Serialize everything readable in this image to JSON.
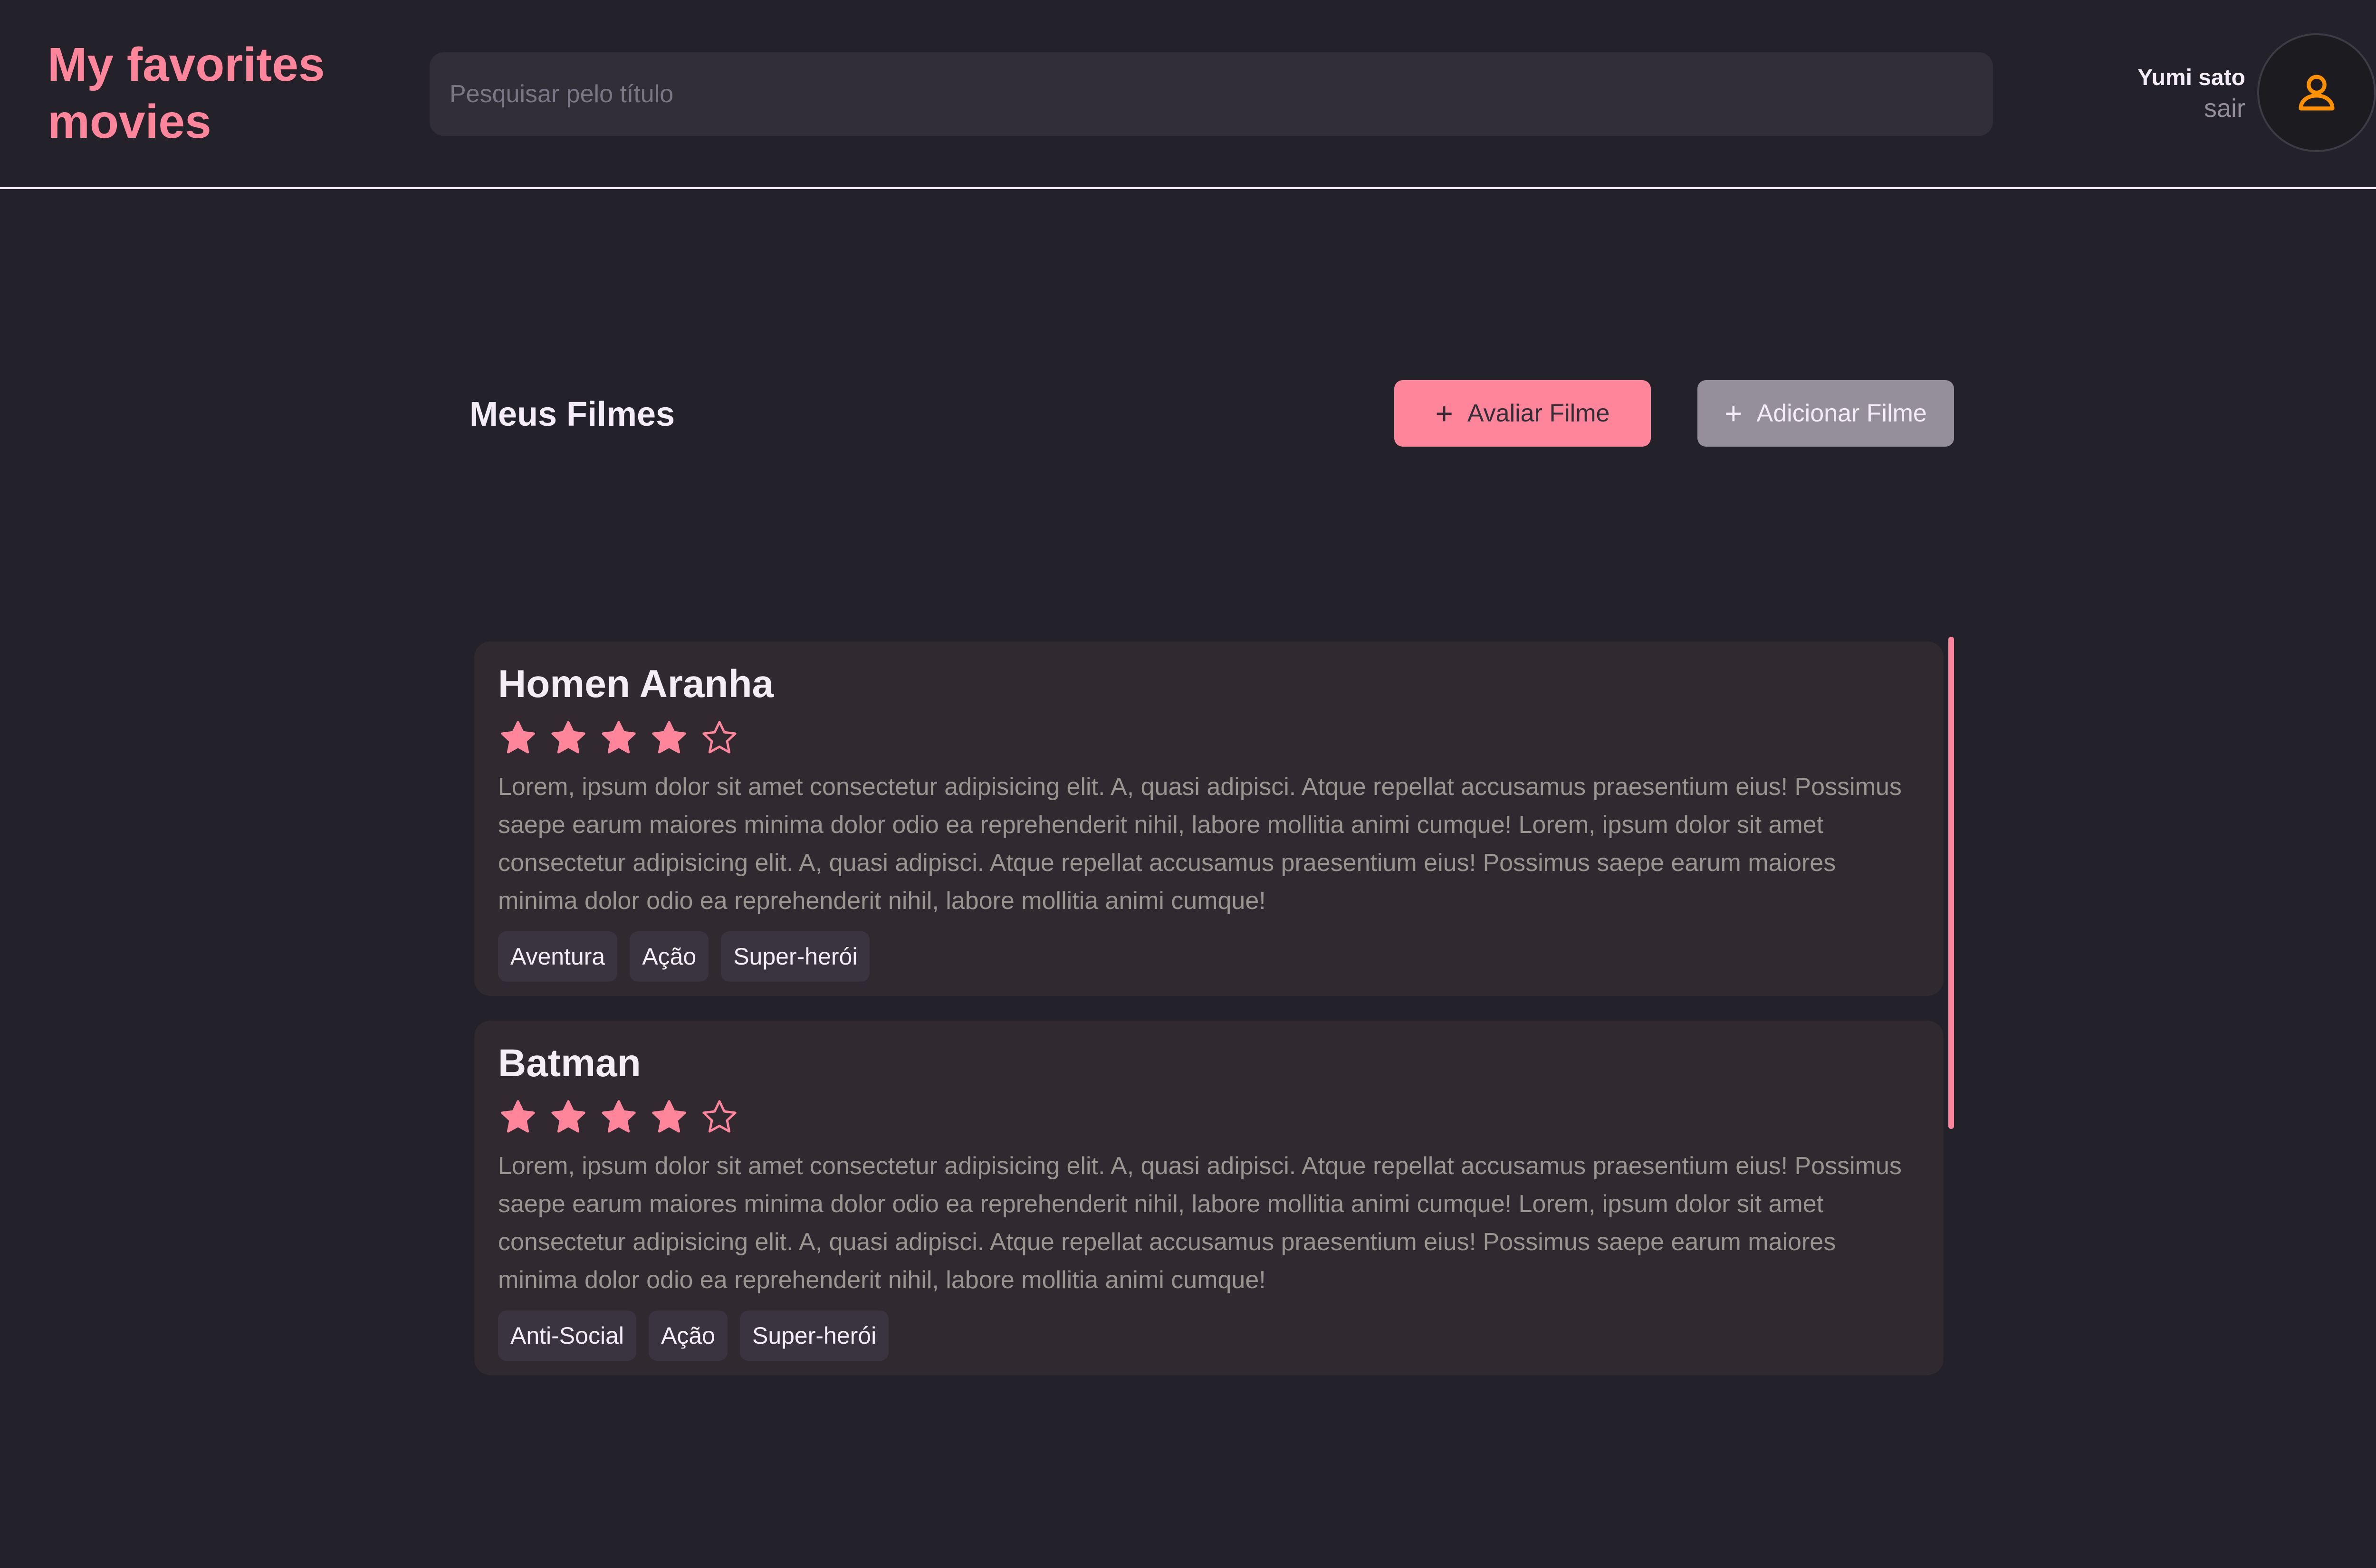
{
  "app": {
    "title": "My favorites movies"
  },
  "search": {
    "placeholder": "Pesquisar pelo título",
    "value": ""
  },
  "user": {
    "name": "Yumi sato",
    "signout_label": "sair",
    "avatar_icon": "user-icon"
  },
  "main": {
    "section_title": "Meus Filmes",
    "rate_button_label": "Avaliar Filme",
    "add_button_label": "Adicionar Filme"
  },
  "movies": [
    {
      "title": "Homen Aranha",
      "rating": 4,
      "max_rating": 5,
      "description": "Lorem, ipsum dolor sit amet consectetur adipisicing elit. A, quasi adipisci. Atque repellat accusamus praesentium eius! Possimus saepe earum maiores minima dolor odio ea reprehenderit nihil, labore mollitia animi cumque! Lorem, ipsum dolor sit amet consectetur adipisicing elit. A, quasi adipisci. Atque repellat accusamus praesentium eius! Possimus saepe earum maiores minima dolor odio ea reprehenderit nihil, labore mollitia animi cumque!",
      "tags": [
        "Aventura",
        "Ação",
        "Super-herói"
      ]
    },
    {
      "title": "Batman",
      "rating": 4,
      "max_rating": 5,
      "description": "Lorem, ipsum dolor sit amet consectetur adipisicing elit. A, quasi adipisci. Atque repellat accusamus praesentium eius! Possimus saepe earum maiores minima dolor odio ea reprehenderit nihil, labore mollitia animi cumque! Lorem, ipsum dolor sit amet consectetur adipisicing elit. A, quasi adipisci. Atque repellat accusamus praesentium eius! Possimus saepe earum maiores minima dolor odio ea reprehenderit nihil, labore mollitia animi cumque!",
      "tags": [
        "Anti-Social",
        "Ação",
        "Super-herói"
      ]
    }
  ],
  "colors": {
    "accent": "#ff859b",
    "background": "#232129",
    "card": "#302a30",
    "tag": "#3a3440",
    "muted": "#948f99",
    "avatar_icon": "#ff9000"
  }
}
